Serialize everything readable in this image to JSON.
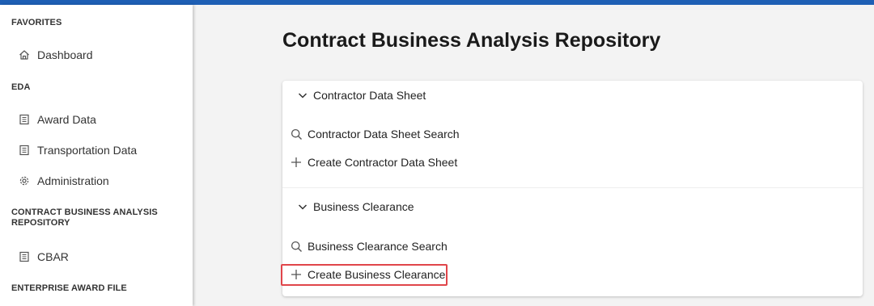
{
  "sidebar": {
    "sections": [
      {
        "title": "FAVORITES",
        "items": [
          {
            "label": "Dashboard",
            "icon": "home-icon"
          }
        ]
      },
      {
        "title": "EDA",
        "items": [
          {
            "label": "Award Data",
            "icon": "document-icon"
          },
          {
            "label": "Transportation Data",
            "icon": "document-icon"
          },
          {
            "label": "Administration",
            "icon": "gear-icon"
          }
        ]
      },
      {
        "title": "CONTRACT BUSINESS ANALYSIS REPOSITORY",
        "items": [
          {
            "label": "CBAR",
            "icon": "document-icon"
          }
        ]
      },
      {
        "title": "ENTERPRISE AWARD FILE",
        "items": []
      }
    ]
  },
  "main": {
    "title": "Contract Business Analysis Repository",
    "groups": [
      {
        "label": "Contractor Data Sheet",
        "actions": [
          {
            "label": "Contractor Data Sheet Search",
            "icon": "search-icon"
          },
          {
            "label": "Create Contractor Data Sheet",
            "icon": "plus-icon"
          }
        ]
      },
      {
        "label": "Business Clearance",
        "actions": [
          {
            "label": "Business Clearance Search",
            "icon": "search-icon"
          },
          {
            "label": "Create Business Clearance",
            "icon": "plus-icon"
          }
        ]
      }
    ]
  },
  "colors": {
    "top_bar": "#1e5fb4",
    "highlight_border": "#e0454a",
    "background": "#f3f3f3"
  }
}
